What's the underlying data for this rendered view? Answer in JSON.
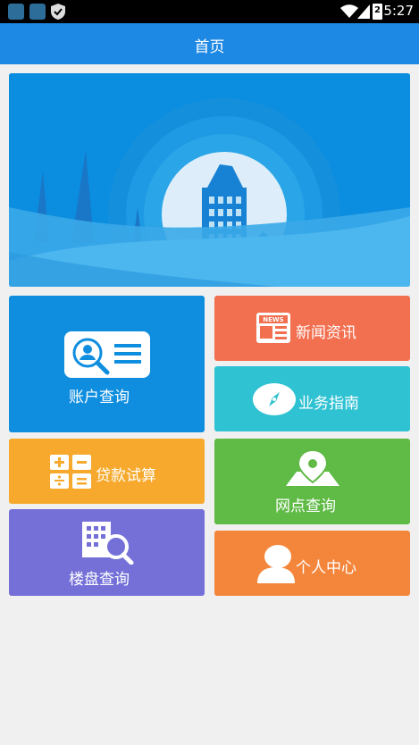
{
  "status_bar": {
    "time": "5:27",
    "battery_level": "2"
  },
  "header": {
    "title": "首页"
  },
  "tiles": {
    "account_query": {
      "label": "账户查询",
      "color": "#0f8ee0"
    },
    "news": {
      "label": "新闻资讯",
      "icon_text": "NEWS",
      "color": "#f26f4f"
    },
    "business_guide": {
      "label": "业务指南",
      "color": "#2fc2d2"
    },
    "loan_calc": {
      "label": "贷款试算",
      "color": "#f6a92c"
    },
    "outlets": {
      "label": "网点查询",
      "color": "#5fba46"
    },
    "property_query": {
      "label": "楼盘查询",
      "color": "#7470d8"
    },
    "personal_center": {
      "label": "个人中心",
      "color": "#f4863c"
    }
  },
  "colors": {
    "app_bar": "#1e88e5",
    "banner": "#0b8de0",
    "background": "#f0f0f0"
  }
}
